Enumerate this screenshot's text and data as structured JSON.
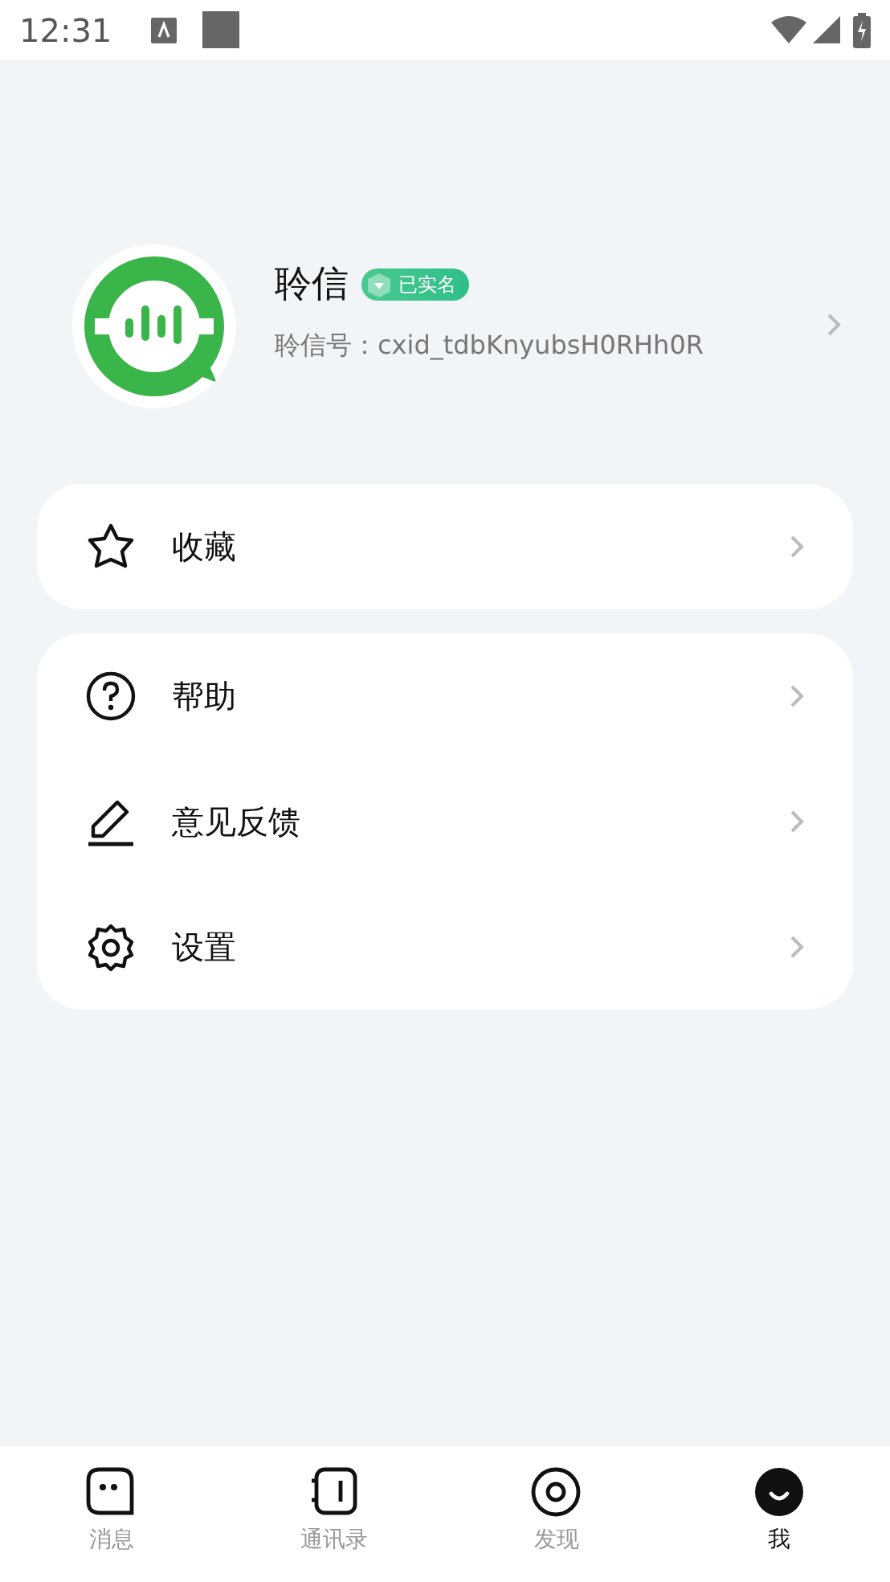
{
  "status_bar": {
    "time": "12:31"
  },
  "profile": {
    "name": "聆信",
    "badge": "已实名",
    "account_id": "聆信号：cxid_tdbKnyubsH0RHh0R"
  },
  "menu_groups": [
    {
      "items": [
        {
          "label": "收藏"
        }
      ]
    },
    {
      "items": [
        {
          "label": "帮助"
        },
        {
          "label": "意见反馈"
        },
        {
          "label": "设置"
        }
      ]
    }
  ],
  "bottom_nav": [
    {
      "label": "消息",
      "selected": false
    },
    {
      "label": "通讯录",
      "selected": false
    },
    {
      "label": "发现",
      "selected": false
    },
    {
      "label": "我",
      "selected": true
    }
  ]
}
